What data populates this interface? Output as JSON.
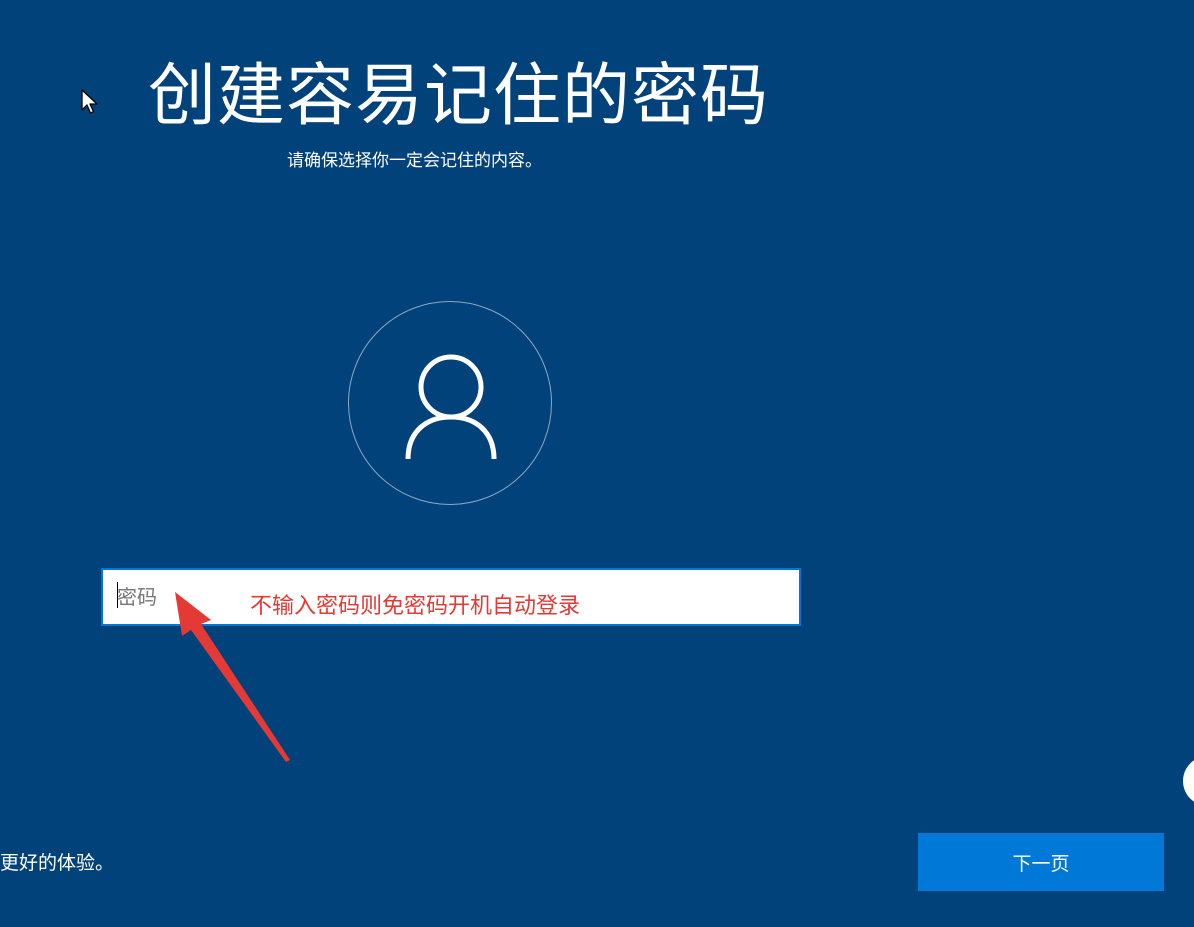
{
  "header": {
    "title": "创建容易记住的密码",
    "subtitle": "请确保选择你一定会记住的内容。"
  },
  "avatar": {
    "icon": "user-icon"
  },
  "password": {
    "placeholder": "密码",
    "value": ""
  },
  "annotation": {
    "text": "不输入密码则免密码开机自动登录",
    "color": "#e53935"
  },
  "footer": {
    "text": "更好的体验。",
    "next_label": "下一页"
  },
  "theme": {
    "background": "#01427a",
    "accent": "#0078d7"
  },
  "icons": {
    "cursor": "mouse-pointer-icon",
    "arrow": "red-arrow-icon",
    "edge_button": "partial-round-button"
  }
}
